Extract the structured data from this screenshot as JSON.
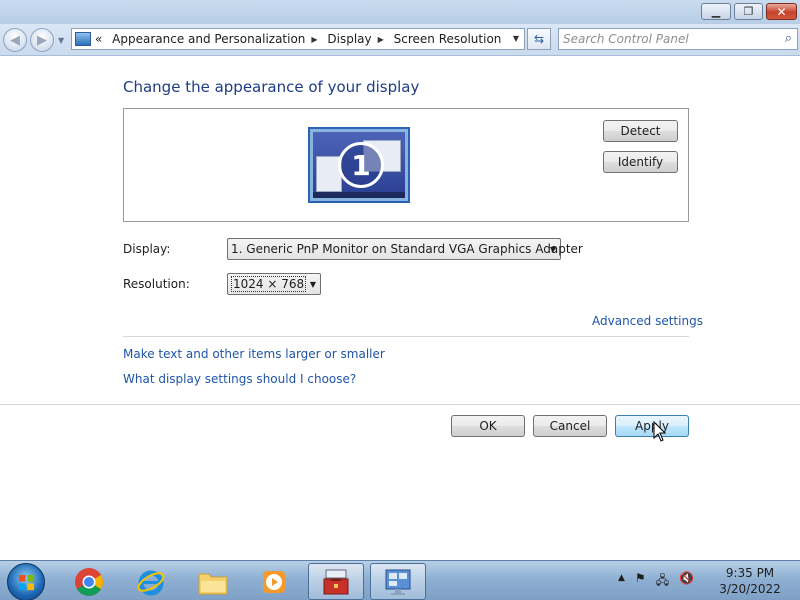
{
  "window": {
    "minimize_glyph": "▁",
    "maximize_glyph": "❐",
    "close_glyph": "✕"
  },
  "nav": {
    "back_glyph": "◀",
    "forward_glyph": "▶",
    "chevron": "«",
    "breadcrumbs": [
      "Appearance and Personalization",
      "Display",
      "Screen Resolution"
    ],
    "refresh_glyph": "⇆",
    "search_placeholder": "Search Control Panel"
  },
  "content": {
    "heading": "Change the appearance of your display",
    "monitor_number": "1",
    "detect_label": "Detect",
    "identify_label": "Identify",
    "display_label": "Display:",
    "display_value": "1. Generic PnP Monitor on Standard VGA Graphics Adapter",
    "resolution_label": "Resolution:",
    "resolution_value": "1024 × 768",
    "advanced_link": "Advanced settings",
    "larger_link": "Make text and other items larger or smaller",
    "choose_link": "What display settings should I choose?"
  },
  "actions": {
    "ok_label": "OK",
    "cancel_label": "Cancel",
    "apply_label": "Apply"
  },
  "taskbar": {
    "apps": [
      "chrome-icon",
      "internet-explorer-icon",
      "file-explorer-icon",
      "media-player-icon",
      "control-panel-icon",
      "display-settings-icon"
    ],
    "tray_up": "▲",
    "time": "9:35 PM",
    "date": "3/20/2022"
  },
  "colors": {
    "link": "#1f55a8",
    "heading": "#1e3c88",
    "title_bar": "#c9dbef",
    "taskbar": "#8fb0d3"
  }
}
